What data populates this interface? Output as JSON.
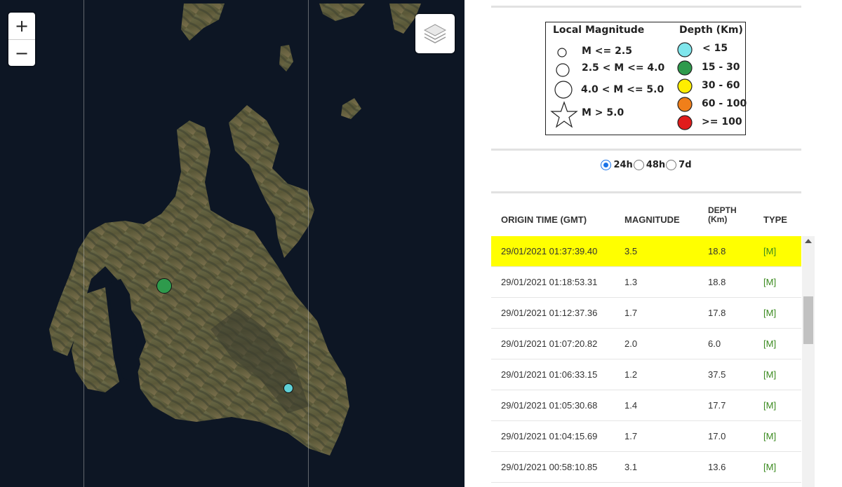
{
  "map": {
    "zoom_in_label": "+",
    "zoom_out_label": "−",
    "layers_icon": "layers-icon",
    "markers": [
      {
        "name": "quake-marker-green",
        "color": "#2e9a4c"
      },
      {
        "name": "quake-marker-cyan",
        "color": "#5fd0d6"
      }
    ]
  },
  "legend": {
    "magnitude_header": "Local Magnitude",
    "depth_header": "Depth (Km)",
    "magnitude_items": [
      {
        "label": "M <= 2.5"
      },
      {
        "label": "2.5 < M <= 4.0"
      },
      {
        "label": "4.0 < M <= 5.0"
      },
      {
        "label": "M > 5.0"
      }
    ],
    "depth_items": [
      {
        "label": "< 15",
        "color": "#7fe6ec"
      },
      {
        "label": "15 - 30",
        "color": "#2e9a4c"
      },
      {
        "label": "30 - 60",
        "color": "#ffee00"
      },
      {
        "label": "60 - 100",
        "color": "#f07f1a"
      },
      {
        "label": ">= 100",
        "color": "#e01b1b"
      }
    ]
  },
  "periods": {
    "options": [
      "24h",
      "48h",
      "7d"
    ],
    "selected": "24h"
  },
  "table": {
    "headers": {
      "origin_time": "ORIGIN TIME (GMT)",
      "magnitude": "MAGNITUDE",
      "depth_line1": "DEPTH",
      "depth_line2": "(Km)",
      "type": "TYPE"
    },
    "rows": [
      {
        "time": "29/01/2021 01:37:39.40",
        "mag": "3.5",
        "depth": "18.8",
        "type": "[M]",
        "highlight": true
      },
      {
        "time": "29/01/2021 01:18:53.31",
        "mag": "1.3",
        "depth": "18.8",
        "type": "[M]"
      },
      {
        "time": "29/01/2021 01:12:37.36",
        "mag": "1.7",
        "depth": "17.8",
        "type": "[M]"
      },
      {
        "time": "29/01/2021 01:07:20.82",
        "mag": "2.0",
        "depth": "6.0",
        "type": "[M]"
      },
      {
        "time": "29/01/2021 01:06:33.15",
        "mag": "1.2",
        "depth": "37.5",
        "type": "[M]"
      },
      {
        "time": "29/01/2021 01:05:30.68",
        "mag": "1.4",
        "depth": "17.7",
        "type": "[M]"
      },
      {
        "time": "29/01/2021 01:04:15.69",
        "mag": "1.7",
        "depth": "17.0",
        "type": "[M]"
      },
      {
        "time": "29/01/2021 00:58:10.85",
        "mag": "3.1",
        "depth": "13.6",
        "type": "[M]"
      }
    ],
    "highlight_color": "#ffff00",
    "type_color": "#3a8a1e"
  }
}
